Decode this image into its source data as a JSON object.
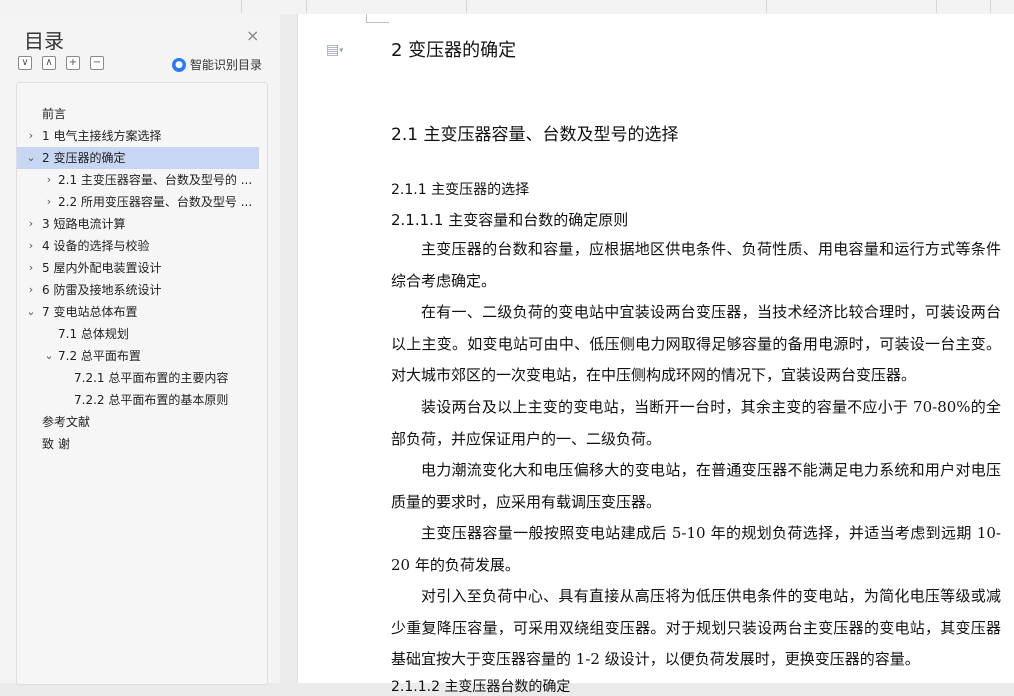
{
  "toc_panel": {
    "title": "目录",
    "close_glyph": "×",
    "tools": [
      {
        "icon": "collapse-all-icon",
        "glyph": "∨"
      },
      {
        "icon": "expand-up-icon",
        "glyph": "∧"
      },
      {
        "icon": "plus-icon",
        "glyph": "+"
      },
      {
        "icon": "minus-icon",
        "glyph": "−"
      }
    ],
    "smart_label": "智能识别目录",
    "items": [
      {
        "label": "前言",
        "level": 0,
        "chevron": ""
      },
      {
        "label": "1  电气主接线方案选择",
        "level": 0,
        "chevron": "›"
      },
      {
        "label": "2  变压器的确定",
        "level": 0,
        "chevron": "⌄",
        "selected": true
      },
      {
        "label": "2.1  主变压器容量、台数及型号的 ...",
        "level": 1,
        "chevron": "›"
      },
      {
        "label": "2.2  所用变压器容量、台数及型号 ...",
        "level": 1,
        "chevron": "›"
      },
      {
        "label": "3  短路电流计算",
        "level": 0,
        "chevron": "›"
      },
      {
        "label": "4  设备的选择与校验",
        "level": 0,
        "chevron": "›"
      },
      {
        "label": "5  屋内外配电装置设计",
        "level": 0,
        "chevron": "›"
      },
      {
        "label": "6  防雷及接地系统设计",
        "level": 0,
        "chevron": "›"
      },
      {
        "label": "7  变电站总体布置",
        "level": 0,
        "chevron": "⌄"
      },
      {
        "label": "7.1  总体规划",
        "level": 1,
        "chevron": ""
      },
      {
        "label": "7.2  总平面布置",
        "level": 1,
        "chevron": "⌄"
      },
      {
        "label": "7.2.1  总平面布置的主要内容",
        "level": 2,
        "chevron": ""
      },
      {
        "label": "7.2.2  总平面布置的基本原则",
        "level": 2,
        "chevron": ""
      },
      {
        "label": "参考文献",
        "level": 0,
        "chevron": ""
      },
      {
        "label": "致    谢",
        "level": 0,
        "chevron": ""
      }
    ]
  },
  "document": {
    "heading1": "2  变压器的确定",
    "heading2": "2.1  主变压器容量、台数及型号的选择",
    "heading3": "2.1.1  主变压器的选择",
    "heading4": "2.1.1.1  主变容量和台数的确定原则",
    "paragraphs": [
      "主变压器的台数和容量，应根据地区供电条件、负荷性质、用电容量和运行方式等条件综合考虑确定。",
      "在有一、二级负荷的变电站中宜装设两台变压器，当技术经济比较合理时，可装设两台以上主变。如变电站可由中、低压侧电力网取得足够容量的备用电源时，可装设一台主变。对大城市郊区的一次变电站，在中压侧构成环网的情况下，宜装设两台变压器。",
      "装设两台及以上主变的变电站，当断开一台时，其余主变的容量不应小于 70-80%的全部负荷，并应保证用户的一、二级负荷。",
      "电力潮流变化大和电压偏移大的变电站，在普通变压器不能满足电力系统和用户对电压质量的要求时，应采用有载调压变压器。",
      "主变压器容量一般按照变电站建成后 5-10 年的规划负荷选择，并适当考虑到远期 10-20 年的负荷发展。",
      "对引入至负荷中心、具有直接从高压将为低压供电条件的变电站，为简化电压等级或减少重复降压容量，可采用双绕组变压器。对于规划只装设两台主变压器的变电站，其变压器基础宜按大于变压器容量的 1-2 级设计，以便负荷发展时，更换变压器的容量。"
    ],
    "cut_line": "2.1.1.2  主变压器台数的确定"
  }
}
